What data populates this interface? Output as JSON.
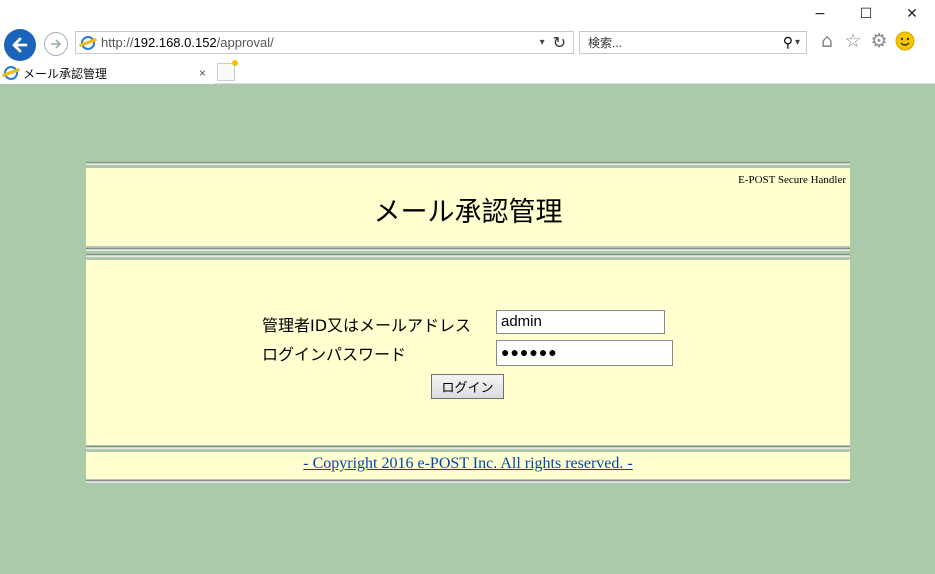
{
  "browser": {
    "window_buttons": {
      "minimize": "−",
      "maximize": "☐",
      "close": "✕"
    },
    "address": {
      "prefix": "http://",
      "host": "192.168.0.152",
      "path": "/approval/"
    },
    "search": {
      "placeholder": "検索..."
    },
    "tab": {
      "title": "メール承認管理",
      "close": "×"
    }
  },
  "page": {
    "brand": "E-POST Secure Handler",
    "title": "メール承認管理",
    "form": {
      "user_label": "管理者ID又はメールアドレス",
      "user_value": "admin",
      "password_label": "ログインパスワード",
      "password_value": "●●●●●●",
      "login_button": "ログイン"
    },
    "copyright": "- Copyright 2016 e-POST Inc. All rights reserved. -"
  },
  "colors": {
    "page_background": "#abcaaa",
    "panel_background": "#ffffd0",
    "link": "#0645ad",
    "back_button": "#1a64b9"
  },
  "icons": [
    "back-icon",
    "forward-icon",
    "ie-icon",
    "refresh-icon",
    "search-icon",
    "home-icon",
    "star-icon",
    "gear-icon",
    "smiley-icon"
  ]
}
